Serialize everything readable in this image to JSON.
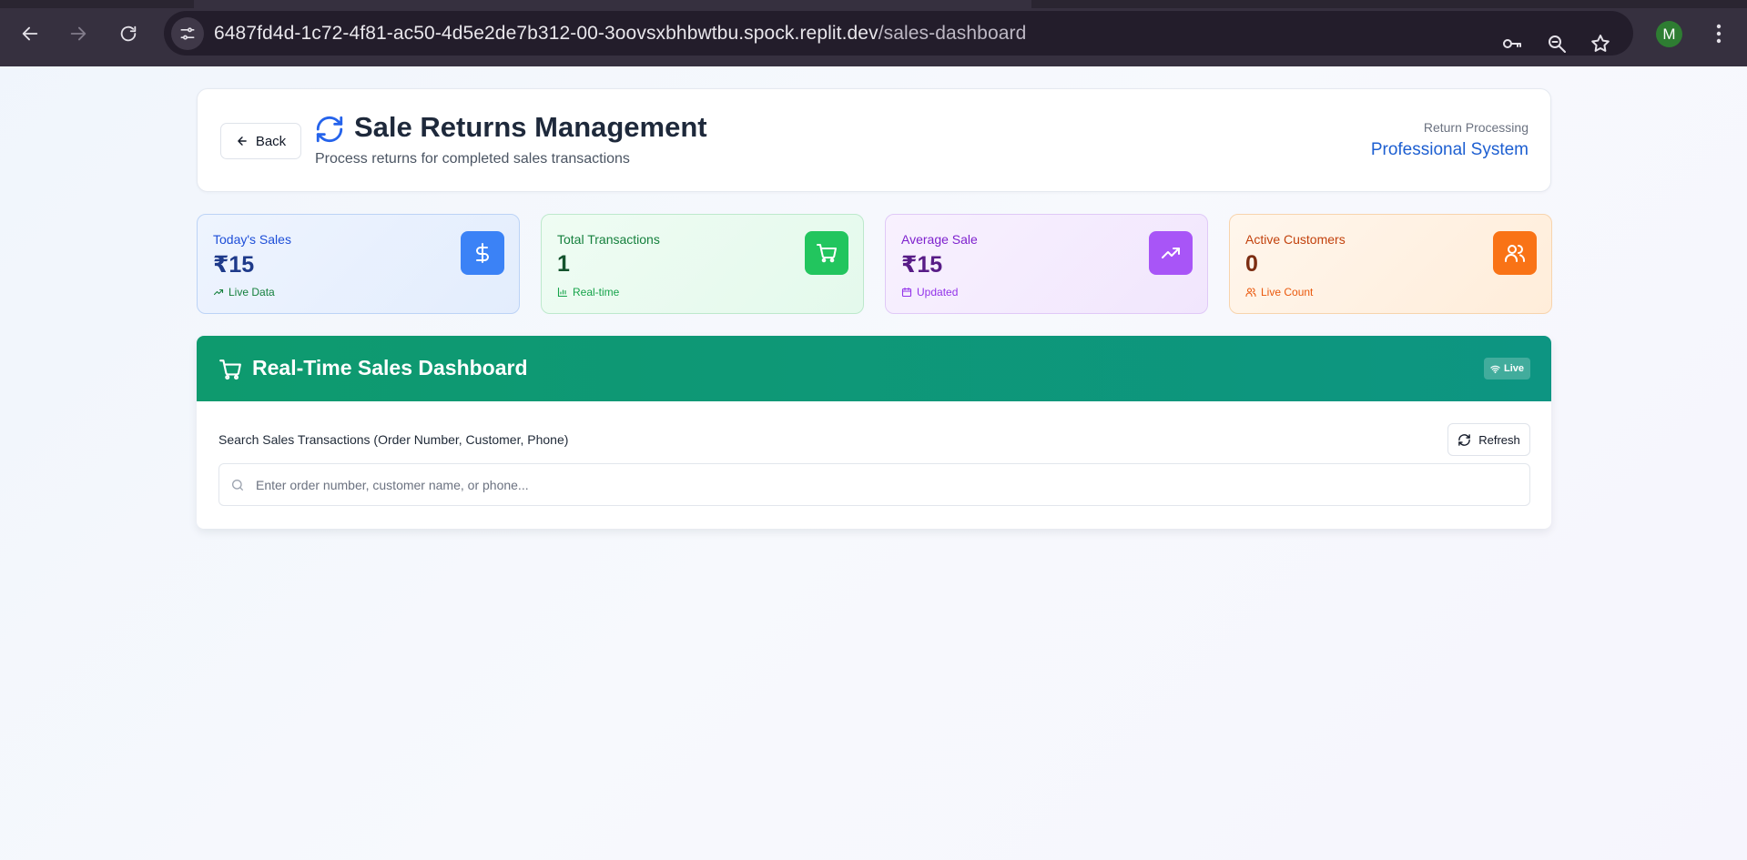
{
  "browser": {
    "url_host": "6487fd4d-1c72-4f81-ac50-4d5e2de7b312-00-3oovsxbhbwtbu.spock.replit.dev",
    "url_path": "/sales-dashboard",
    "avatar_letter": "M"
  },
  "header": {
    "back_label": "Back",
    "title": "Sale Returns Management",
    "subtitle": "Process returns for completed sales transactions",
    "right_label": "Return Processing",
    "right_value": "Professional System"
  },
  "stats": [
    {
      "label": "Today's Sales",
      "value": "₹15",
      "sub": "Live Data",
      "icon": "dollar-icon",
      "color": "#3b82f6"
    },
    {
      "label": "Total Transactions",
      "value": "1",
      "sub": "Real-time",
      "icon": "cart-icon",
      "color": "#22c55e"
    },
    {
      "label": "Average Sale",
      "value": "₹15",
      "sub": "Updated",
      "icon": "trending-up-icon",
      "color": "#a855f7"
    },
    {
      "label": "Active Customers",
      "value": "0",
      "sub": "Live Count",
      "icon": "users-icon",
      "color": "#f97316"
    }
  ],
  "dashboard": {
    "title": "Real-Time Sales Dashboard",
    "live_label": "Live",
    "search_label": "Search Sales Transactions (Order Number, Customer, Phone)",
    "refresh_label": "Refresh",
    "search_placeholder": "Enter order number, customer name, or phone...",
    "header_color": "#0e9a6e"
  }
}
